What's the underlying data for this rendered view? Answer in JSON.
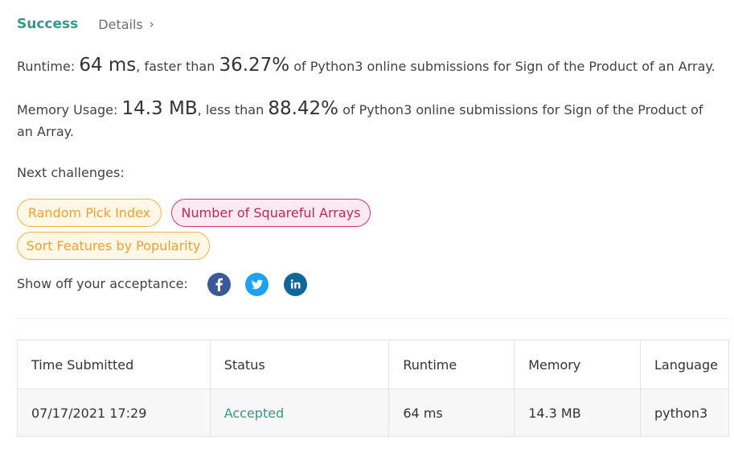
{
  "header": {
    "status": "Success",
    "details_label": "Details",
    "chevron_glyph": "›"
  },
  "runtime": {
    "label": "Runtime: ",
    "value": "64 ms",
    "middle": ", faster than ",
    "percent": "36.27%",
    "suffix": " of Python3 online submissions for Sign of the Product of an Array."
  },
  "memory": {
    "label": "Memory Usage: ",
    "value": "14.3 MB",
    "middle": ", less than ",
    "percent": "88.42%",
    "suffix": " of Python3 online submissions for Sign of the Product of an Array."
  },
  "next_challenges": {
    "label": "Next challenges:",
    "items": [
      {
        "label": "Random Pick Index",
        "difficulty_color": "#f0a030"
      },
      {
        "label": "Number of Squareful Arrays",
        "difficulty_color": "#c2255c"
      },
      {
        "label": "Sort Features by Popularity",
        "difficulty_color": "#f0a030"
      }
    ]
  },
  "share": {
    "label": "Show off your acceptance:",
    "icons": [
      {
        "name": "facebook-icon",
        "color": "#3b5998"
      },
      {
        "name": "twitter-icon",
        "color": "#1da1f2"
      },
      {
        "name": "linkedin-icon",
        "color": "#0e6796"
      }
    ]
  },
  "table": {
    "columns": [
      "Time Submitted",
      "Status",
      "Runtime",
      "Memory",
      "Language"
    ],
    "rows": [
      {
        "time": "07/17/2021 17:29",
        "status": "Accepted",
        "runtime": "64 ms",
        "memory": "14.3 MB",
        "language": "python3"
      }
    ]
  },
  "colors": {
    "accent_green": "#3a9689",
    "medium_orange": "#f0a030",
    "hard_pink": "#c2255c"
  }
}
